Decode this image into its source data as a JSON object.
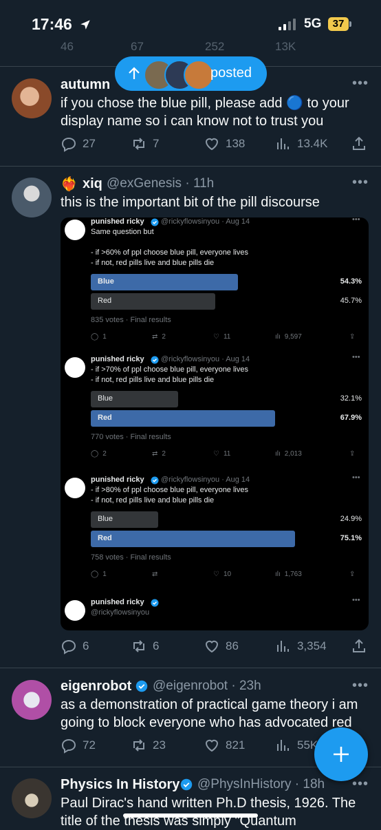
{
  "status_bar": {
    "time": "17:46",
    "network": "5G",
    "battery": "37"
  },
  "top_partial_counts": {
    "replies": "46",
    "reposts": "67",
    "likes": "252",
    "views": "13K"
  },
  "posted_pill": {
    "label": "posted"
  },
  "tweets": [
    {
      "name": "autumn",
      "text": "if you chose the blue pill, please add 🔵 to your display name so i can know not to trust you",
      "replies": "27",
      "reposts": "7",
      "likes": "138",
      "views": "13.4K"
    },
    {
      "emoji": "❤️‍🔥",
      "name": "xiq",
      "handle": "@exGenesis",
      "time": "11h",
      "text": "this is the important bit of the pill discourse",
      "replies": "6",
      "reposts": "6",
      "likes": "86",
      "views": "3,354"
    },
    {
      "name": "eigenrobot",
      "handle": "@eigenrobot",
      "time": "23h",
      "text": "as a demonstration of practical game theory i am going to block everyone who has advocated red",
      "replies": "72",
      "reposts": "23",
      "likes": "821",
      "views": "55K"
    },
    {
      "name": "Physics In History",
      "handle": "@PhysInHistory",
      "time": "18h",
      "text": "Paul Dirac's hand written Ph.D thesis, 1926. The title of the thesis was simply \"Quantum"
    }
  ],
  "embed": {
    "author": "punished ricky",
    "handle": "@rickyflowsinyou",
    "date": "Aug 14",
    "polls": [
      {
        "text": [
          "Same question but",
          "",
          "- if >60% of ppl choose blue pill, everyone lives",
          "- if not, red pills live and blue pills die"
        ],
        "options": [
          {
            "label": "Blue",
            "pct": "54.3%",
            "value": 54.3,
            "leading": true
          },
          {
            "label": "Red",
            "pct": "45.7%",
            "value": 45.7,
            "leading": false
          }
        ],
        "votes": "835 votes · Final results",
        "replies": "1",
        "reposts": "2",
        "likes": "11",
        "views": "9,597"
      },
      {
        "text": [
          "- if >70% of ppl choose blue pill, everyone lives",
          "- if not, red pills live and blue pills die"
        ],
        "options": [
          {
            "label": "Blue",
            "pct": "32.1%",
            "value": 32.1,
            "leading": false
          },
          {
            "label": "Red",
            "pct": "67.9%",
            "value": 67.9,
            "leading": true
          }
        ],
        "votes": "770 votes · Final results",
        "replies": "2",
        "reposts": "2",
        "likes": "11",
        "views": "2,013"
      },
      {
        "text": [
          "- if >80% of ppl choose blue pill, everyone lives",
          "- if not, red pills live and blue pills die"
        ],
        "options": [
          {
            "label": "Blue",
            "pct": "24.9%",
            "value": 24.9,
            "leading": false
          },
          {
            "label": "Red",
            "pct": "75.1%",
            "value": 75.1,
            "leading": true
          }
        ],
        "votes": "758 votes · Final results",
        "replies": "1",
        "reposts": "",
        "likes": "10",
        "views": "1,763"
      }
    ]
  },
  "colors": {
    "background": "#15202b",
    "accent": "#1d9bf0",
    "bar_leading": "#3d6aa8",
    "bar_other": "#333639"
  }
}
